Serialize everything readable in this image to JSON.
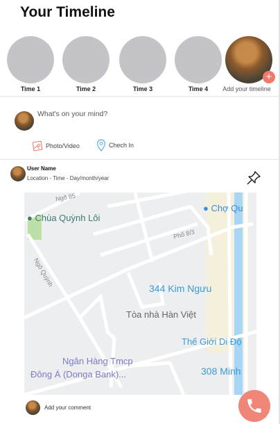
{
  "header": {
    "title": "Your Timeline"
  },
  "stories": [
    {
      "label": "Time 1"
    },
    {
      "label": "Time 2"
    },
    {
      "label": "Time 3"
    },
    {
      "label": "Time 4"
    }
  ],
  "add_story": {
    "label": "Add your timeline",
    "plus": "+"
  },
  "composer": {
    "placeholder": "What's on your mind?",
    "photo_label": "Photo/Video",
    "checkin_label": "Chech In"
  },
  "post": {
    "user_name": "User Name",
    "meta": "Location - Time - Day/month/year",
    "map_labels": {
      "pagoda": "Chùa Quỳnh Lôi",
      "market": "Chợ Qu",
      "alley85": "Ngõ 85",
      "street83": "Phố 8/3",
      "alleyQ": "Ngõ Quỳnh",
      "kimnguu": "344 Kim Ngưu",
      "hanviet": "Tòa nhà Hàn Việt",
      "tgdd": "Thế Giới Di Độ",
      "bank1": "Ngân Hàng Tmcp",
      "bank2": "Đông Á (Donga Bank)...",
      "minh": "308 Minh"
    }
  },
  "comment": {
    "placeholder": "Add your comment"
  },
  "colors": {
    "accent": "#ef7a6c",
    "map_blue": "#3a9ad9"
  }
}
